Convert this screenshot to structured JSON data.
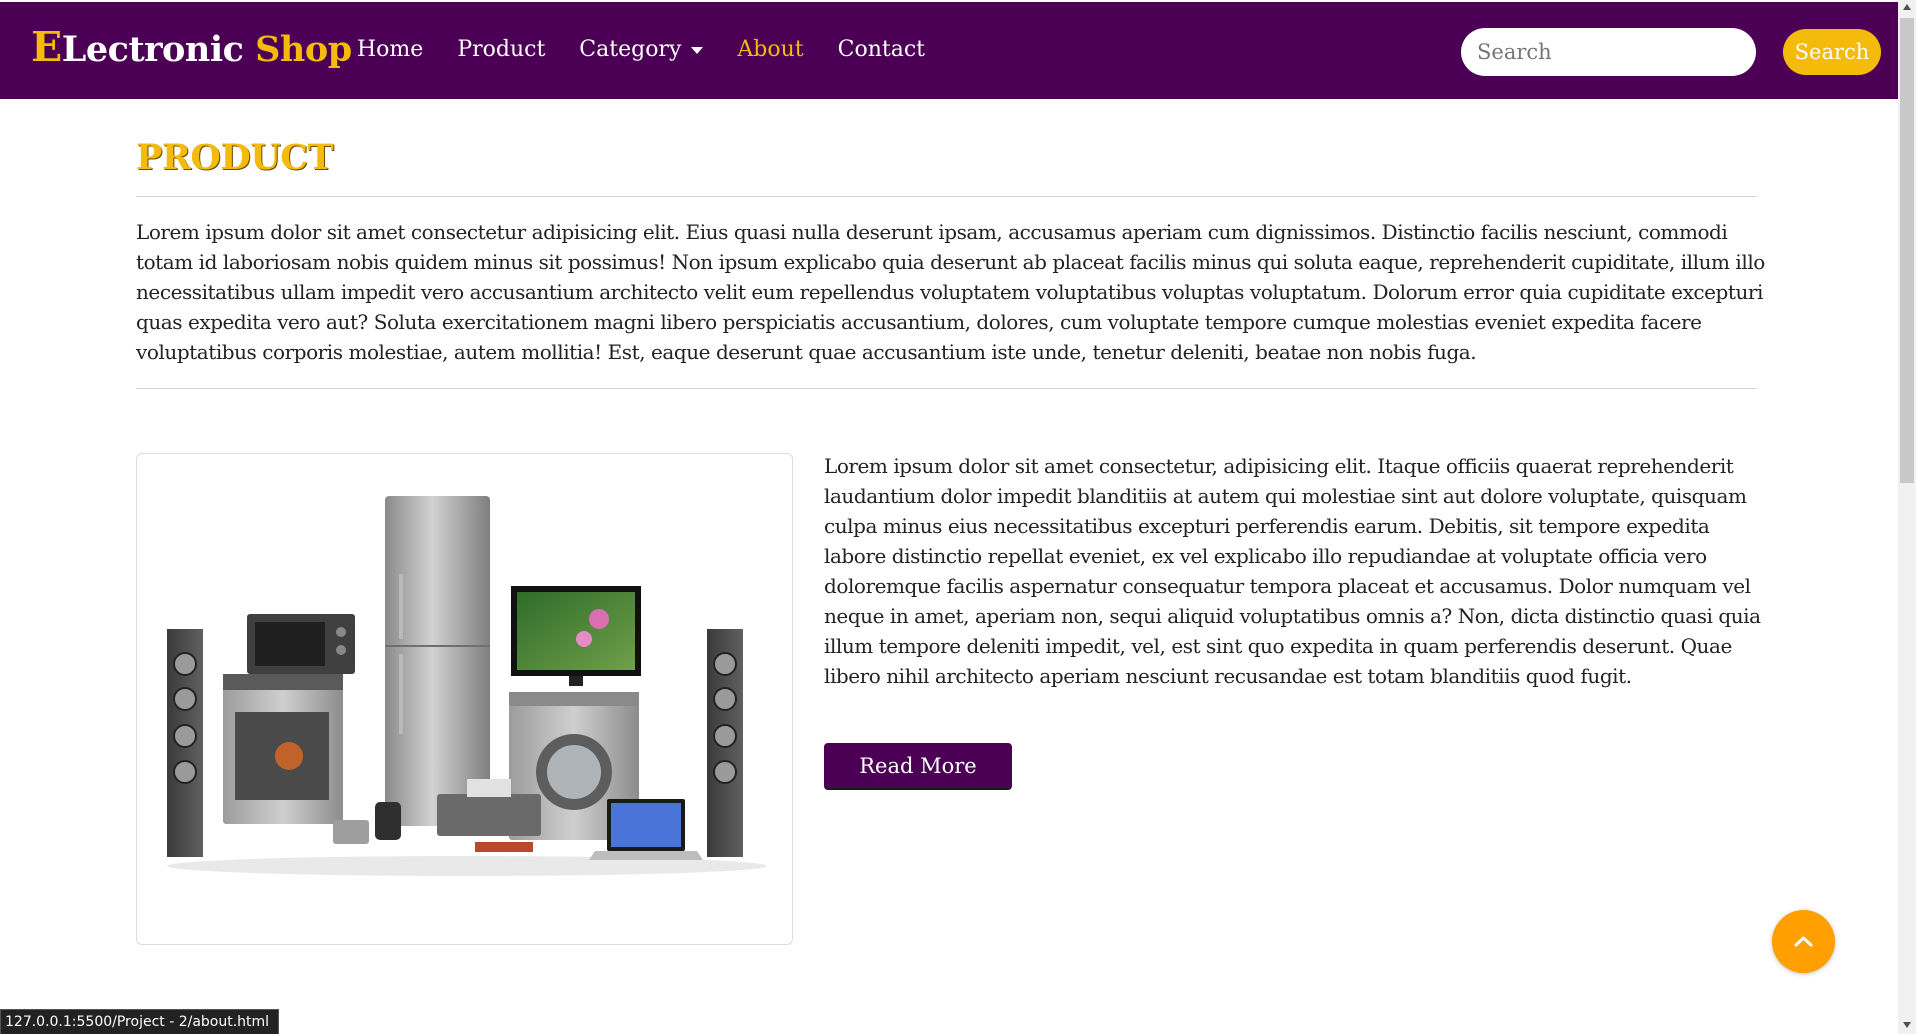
{
  "brand": {
    "part1": "E",
    "part2": "Lectronic ",
    "part3": "Shop"
  },
  "nav": {
    "items": [
      {
        "label": "Home"
      },
      {
        "label": "Product"
      },
      {
        "label": "Category"
      },
      {
        "label": "About"
      },
      {
        "label": "Contact"
      }
    ],
    "active": "About"
  },
  "search": {
    "placeholder": "Search",
    "value": "",
    "button_label": "Search"
  },
  "main": {
    "title": "PRODUCT",
    "intro": "Lorem ipsum dolor sit amet consectetur adipisicing elit. Eius quasi nulla deserunt ipsam, accusamus aperiam cum dignissimos. Distinctio facilis nesciunt, commodi totam id laboriosam nobis quidem minus sit possimus! Non ipsum explicabo quia deserunt ab placeat facilis minus qui soluta eaque, reprehenderit cupiditate, illum illo necessitatibus ullam impedit vero accusantium architecto velit eum repellendus voluptatem voluptatibus voluptas voluptatum. Dolorum error quia cupiditate excepturi quas expedita vero aut? Soluta exercitationem magni libero perspiciatis accusantium, dolores, cum voluptate tempore cumque molestias eveniet expedita facere voluptatibus corporis molestiae, autem mollitia! Est, eaque deserunt quae accusantium iste unde, tenetur deleniti, beatae non nobis fuga.",
    "description": "Lorem ipsum dolor sit amet consectetur, adipisicing elit. Itaque officiis quaerat reprehenderit laudantium dolor impedit blanditiis at autem qui molestiae sint aut dolore voluptate, quisquam culpa minus eius necessitatibus excepturi perferendis earum. Debitis, sit tempore expedita labore distinctio repellat eveniet, ex vel explicabo illo repudiandae at voluptate officia vero doloremque facilis aspernatur consequatur tempora placeat et accusamus. Dolor numquam vel neque in amet, aperiam non, sequi aliquid voluptatibus omnis a? Non, dicta distinctio quasi quia illum tempore deleniti impedit, vel, est sint quo expedita in quam perferendis deserunt. Quae libero nihil architecto aperiam nesciunt recusandae est totam blanditiis quod fugit.",
    "read_more_label": "Read More",
    "product_image": "home-appliances-electronics-image"
  },
  "back_to_top_icon": "chevron-up-icon",
  "status_bar": {
    "url": "127.0.0.1:5500/Project - 2/about.html"
  },
  "colors": {
    "navbar_bg": "#4b0055",
    "accent": "#f4bb0a",
    "button_primary": "#4b0055",
    "back_to_top": "#ff9f00"
  }
}
